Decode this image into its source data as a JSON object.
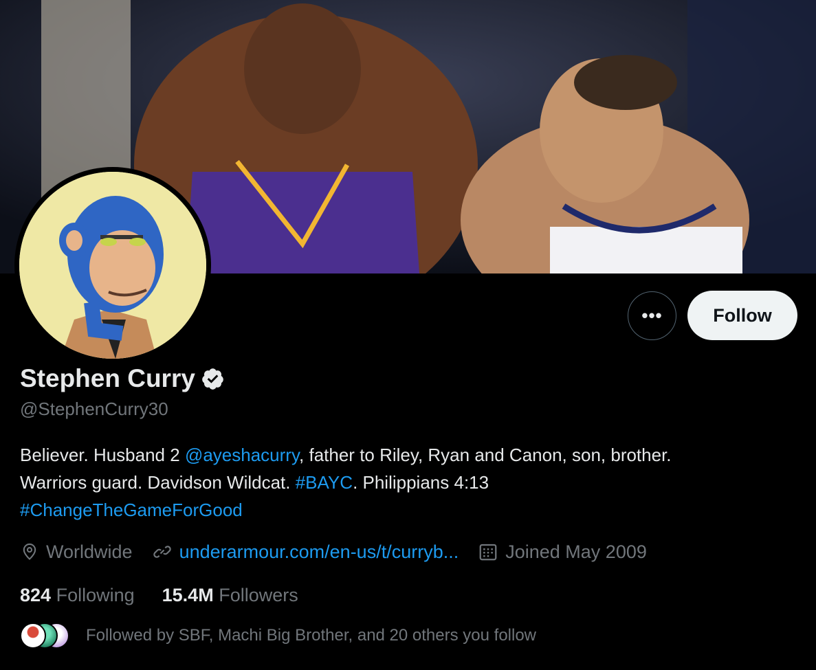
{
  "profile": {
    "display_name": "Stephen Curry",
    "handle": "@StephenCurry30",
    "verified": true
  },
  "actions": {
    "more_label": "•••",
    "follow_label": "Follow"
  },
  "bio": {
    "part1": "Believer. Husband 2 ",
    "mention": "@ayeshacurry",
    "part2": ", father to Riley, Ryan and Canon, son, brother.",
    "part3": "Warriors guard. Davidson Wildcat. ",
    "hashtag1": "#BAYC",
    "part4": ". Philippians 4:13",
    "hashtag2": "#ChangeTheGameForGood"
  },
  "meta": {
    "location": "Worldwide",
    "link": "underarmour.com/en-us/t/curryb...",
    "joined": "Joined May 2009"
  },
  "stats": {
    "following_count": "824",
    "following_label": "Following",
    "followers_count": "15.4M",
    "followers_label": "Followers"
  },
  "followed_by": {
    "text": "Followed by SBF, Machi Big Brother, and 20 others you follow"
  },
  "colors": {
    "background": "#000000",
    "accent": "#1d9bf0",
    "follow_button_bg": "#eff3f4",
    "muted_text": "#71767b"
  },
  "icons": [
    "location-icon",
    "link-icon",
    "calendar-icon",
    "verified-badge-icon",
    "more-icon"
  ]
}
